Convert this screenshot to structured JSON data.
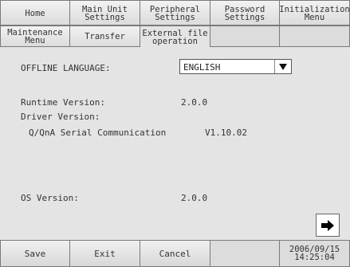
{
  "tabs_row1": [
    {
      "label": "Home"
    },
    {
      "label": "Main Unit\nSettings"
    },
    {
      "label": "Peripheral\nSettings"
    },
    {
      "label": "Password\nSettings"
    },
    {
      "label": "Initialization\nMenu"
    }
  ],
  "tabs_row2": [
    {
      "label": "Maintenance\nMenu"
    },
    {
      "label": "Transfer"
    },
    {
      "label": "External file\noperation"
    }
  ],
  "content": {
    "offline_language_label": "OFFLINE LANGUAGE:",
    "offline_language_value": "ENGLISH",
    "runtime_version_label": "Runtime Version:",
    "runtime_version_value": "2.0.0",
    "driver_version_label": "Driver Version:",
    "driver_name": "Q/QnA Serial Communication",
    "driver_version_value": "V1.10.02",
    "os_version_label": "OS Version:",
    "os_version_value": "2.0.0"
  },
  "bottom": {
    "save_label": "Save",
    "exit_label": "Exit",
    "cancel_label": "Cancel",
    "clock": "2006/09/15\n14:25:04"
  },
  "icons": {
    "dropdown": "triangle-down-icon",
    "next": "arrow-right-icon"
  }
}
